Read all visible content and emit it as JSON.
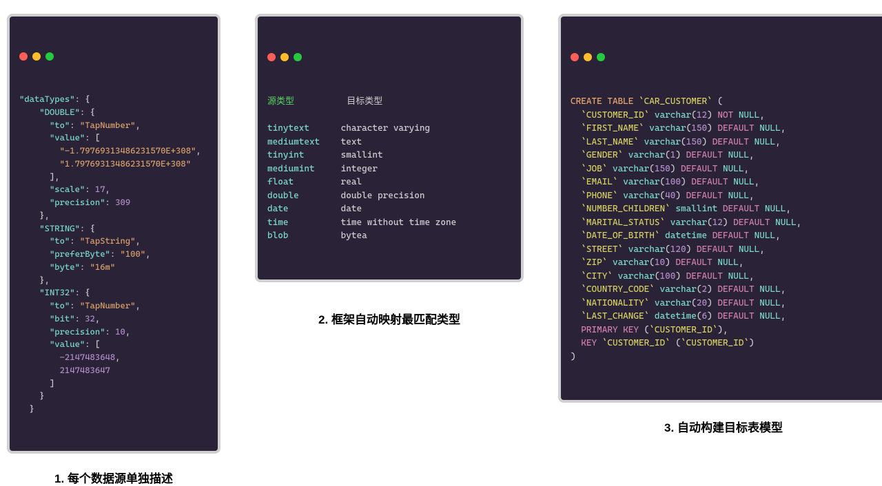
{
  "captions": {
    "left": "1. 每个数据源单独描述",
    "mid": "2. 框架自动映射最匹配类型",
    "right": "3. 自动构建目标表模型"
  },
  "panel1": {
    "root_key": "dataTypes",
    "types": {
      "DOUBLE": {
        "to": "TapNumber",
        "value": [
          "-1.79769313486231570E+308",
          "1.79769313486231570E+308"
        ],
        "scale": 17,
        "precision": 309
      },
      "STRING": {
        "to": "TapString",
        "preferByte": "100",
        "byte": "16m"
      },
      "INT32": {
        "to": "TapNumber",
        "bit": 32,
        "precision": 10,
        "value": [
          -2147483648,
          2147483647
        ]
      }
    }
  },
  "panel2": {
    "header_src": "源类型",
    "header_tgt": "目标类型",
    "rows": [
      {
        "src": "tinytext",
        "tgt": "character varying"
      },
      {
        "src": "mediumtext",
        "tgt": "text"
      },
      {
        "src": "tinyint",
        "tgt": "smallint"
      },
      {
        "src": "mediumint",
        "tgt": "integer"
      },
      {
        "src": "float",
        "tgt": "real"
      },
      {
        "src": "double",
        "tgt": "double precision"
      },
      {
        "src": "date",
        "tgt": "date"
      },
      {
        "src": "time",
        "tgt": "time without time zone"
      },
      {
        "src": "blob",
        "tgt": "bytea"
      }
    ]
  },
  "panel3": {
    "create": "CREATE TABLE",
    "table": "CAR_CUSTOMER",
    "cols": [
      {
        "name": "CUSTOMER_ID",
        "type": "varchar",
        "len": 12,
        "constraint": "NOT NULL"
      },
      {
        "name": "FIRST_NAME",
        "type": "varchar",
        "len": 150,
        "constraint": "DEFAULT NULL"
      },
      {
        "name": "LAST_NAME",
        "type": "varchar",
        "len": 150,
        "constraint": "DEFAULT NULL"
      },
      {
        "name": "GENDER",
        "type": "varchar",
        "len": 1,
        "constraint": "DEFAULT NULL"
      },
      {
        "name": "JOB",
        "type": "varchar",
        "len": 150,
        "constraint": "DEFAULT NULL"
      },
      {
        "name": "EMAIL",
        "type": "varchar",
        "len": 100,
        "constraint": "DEFAULT NULL"
      },
      {
        "name": "PHONE",
        "type": "varchar",
        "len": 40,
        "constraint": "DEFAULT NULL"
      },
      {
        "name": "NUMBER_CHILDREN",
        "type": "smallint",
        "len": null,
        "constraint": "DEFAULT NULL"
      },
      {
        "name": "MARITAL_STATUS",
        "type": "varchar",
        "len": 12,
        "constraint": "DEFAULT NULL"
      },
      {
        "name": "DATE_OF_BIRTH",
        "type": "datetime",
        "len": null,
        "constraint": "DEFAULT NULL"
      },
      {
        "name": "STREET",
        "type": "varchar",
        "len": 120,
        "constraint": "DEFAULT NULL"
      },
      {
        "name": "ZIP",
        "type": "varchar",
        "len": 10,
        "constraint": "DEFAULT NULL"
      },
      {
        "name": "CITY",
        "type": "varchar",
        "len": 100,
        "constraint": "DEFAULT NULL"
      },
      {
        "name": "COUNTRY_CODE",
        "type": "varchar",
        "len": 2,
        "constraint": "DEFAULT NULL"
      },
      {
        "name": "NATIONALITY",
        "type": "varchar",
        "len": 20,
        "constraint": "DEFAULT NULL"
      },
      {
        "name": "LAST_CHANGE",
        "type": "datetime",
        "len": 6,
        "constraint": "DEFAULT NULL"
      }
    ],
    "pk": "CUSTOMER_ID",
    "key_name": "CUSTOMER_ID",
    "key_col": "CUSTOMER_ID"
  }
}
